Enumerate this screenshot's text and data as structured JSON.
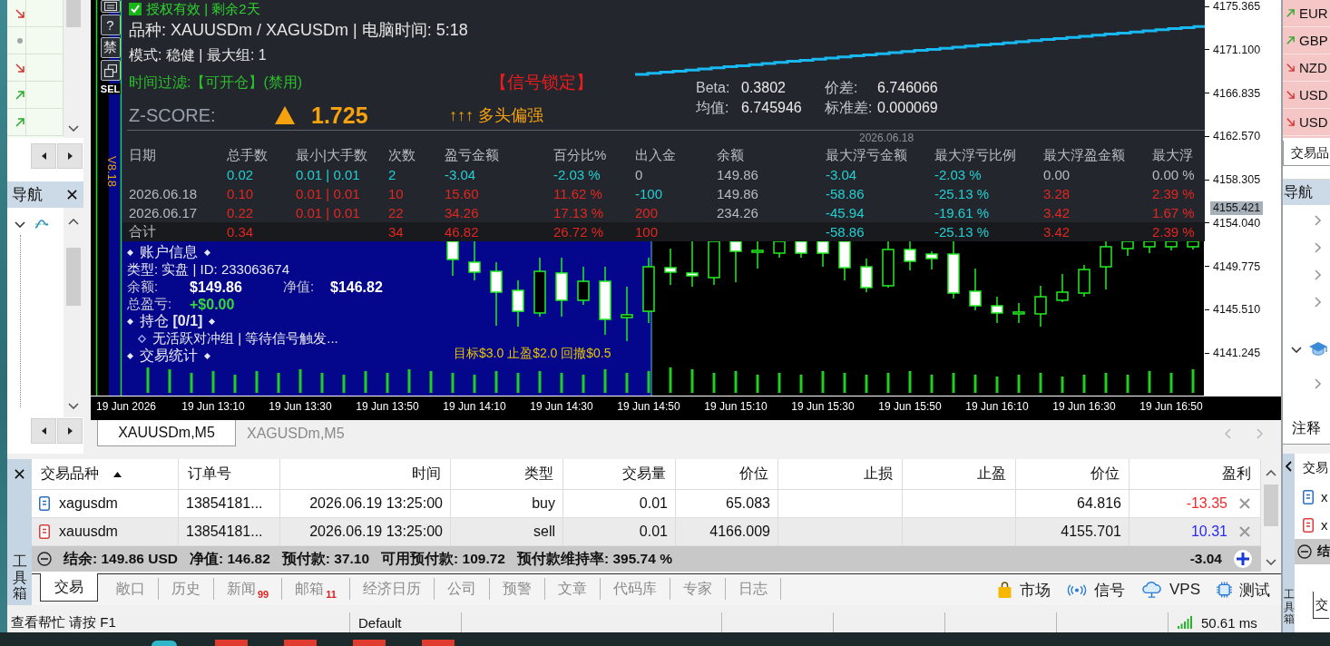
{
  "left_panel": {
    "market_rows": [
      {
        "kind": "down"
      },
      {
        "kind": "flat"
      },
      {
        "kind": "down"
      },
      {
        "kind": "up"
      },
      {
        "kind": "up"
      }
    ],
    "navigator_title": "导航",
    "navigator_tree": [
      {
        "kind": "indicators",
        "expanded": true
      }
    ]
  },
  "chart": {
    "side_buttons": [
      {
        "kind": "list"
      },
      {
        "kind": "text",
        "label": "?"
      },
      {
        "kind": "text",
        "label": "禁"
      },
      {
        "kind": "window"
      }
    ],
    "side_label": "SEL",
    "version": "V8.18",
    "panel": {
      "license": {
        "checked": true,
        "text": "授权有效 | 剩余2天"
      },
      "symbols": "品种: XAUUSDm / XAGUSDm  |  电脑时间: 5:18",
      "mode": "模式: 稳健 | 最大组: 1",
      "time_filter": "时间过滤:【可开仓】(禁用)",
      "signal": "【信号锁定】",
      "zscore": {
        "label": "Z-SCORE:",
        "rising": true,
        "value": "1.725",
        "bias": "↑↑↑ 多头偏强"
      },
      "stats": [
        {
          "label": "Beta:",
          "value": "0.3802"
        },
        {
          "label": "价差:",
          "value": "6.746066"
        },
        {
          "label": "均值:",
          "value": "6.745946"
        },
        {
          "label": "标准差:",
          "value": "0.000069"
        }
      ],
      "daily_table": {
        "date": "2026.06.18",
        "columns": [
          "日期",
          "总手数",
          "最小|大手数",
          "次数",
          "盈亏金额",
          "百分比%",
          "出入金",
          "余额",
          "最大浮亏金额",
          "最大浮亏比例",
          "最大浮盈金额",
          "最大浮"
        ],
        "rows": [
          {
            "kind": "day",
            "cells": [
              null,
              {
                "text": "0.02",
                "color": "#22d0d4"
              },
              {
                "text": "0.01 | 0.01",
                "color": "#22d0d4"
              },
              {
                "text": "2",
                "color": "#22d0d4"
              },
              {
                "text": "-3.04",
                "color": "#22d0d4"
              },
              {
                "text": "-2.03 %",
                "color": "#22d0d4"
              },
              {
                "text": "0",
                "color": "#b8bcc2"
              },
              {
                "text": "149.86",
                "color": "#b8bcc2"
              },
              {
                "text": "-3.04",
                "color": "#22d0d4"
              },
              {
                "text": "-2.03 %",
                "color": "#22d0d4"
              },
              {
                "text": "0.00",
                "color": "#b8bcc2"
              },
              {
                "text": "0.00 %",
                "color": "#b8bcc2"
              }
            ]
          },
          {
            "kind": "day",
            "cells": [
              {
                "text": "2026.06.18",
                "color": "#b8bcc2"
              },
              {
                "text": "0.10",
                "color": "#e42620"
              },
              {
                "text": "0.01 | 0.01",
                "color": "#e42620"
              },
              {
                "text": "10",
                "color": "#e42620"
              },
              {
                "text": "15.60",
                "color": "#e42620"
              },
              {
                "text": "11.62 %",
                "color": "#e42620"
              },
              {
                "text": "-100",
                "color": "#22d0d4"
              },
              {
                "text": "149.86",
                "color": "#b8bcc2"
              },
              {
                "text": "-58.86",
                "color": "#22d0d4"
              },
              {
                "text": "-25.13 %",
                "color": "#22d0d4"
              },
              {
                "text": "3.28",
                "color": "#e42620"
              },
              {
                "text": "2.39 %",
                "color": "#e42620"
              }
            ]
          },
          {
            "kind": "day",
            "cells": [
              {
                "text": "2026.06.17",
                "color": "#b8bcc2"
              },
              {
                "text": "0.22",
                "color": "#e42620"
              },
              {
                "text": "0.01 | 0.01",
                "color": "#e42620"
              },
              {
                "text": "22",
                "color": "#e42620"
              },
              {
                "text": "34.26",
                "color": "#e42620"
              },
              {
                "text": "17.13 %",
                "color": "#e42620"
              },
              {
                "text": "200",
                "color": "#e42620"
              },
              {
                "text": "234.26",
                "color": "#b8bcc2"
              },
              {
                "text": "-45.94",
                "color": "#22d0d4"
              },
              {
                "text": "-19.61 %",
                "color": "#22d0d4"
              },
              {
                "text": "3.42",
                "color": "#e42620"
              },
              {
                "text": "1.67 %",
                "color": "#e42620"
              }
            ]
          },
          {
            "kind": "total",
            "cells": [
              {
                "text": "合计",
                "color": "#b8bcc2"
              },
              {
                "text": "0.34",
                "color": "#e42620"
              },
              null,
              {
                "text": "34",
                "color": "#e42620"
              },
              {
                "text": "46.82",
                "color": "#e42620"
              },
              {
                "text": "26.72 %",
                "color": "#e42620"
              },
              {
                "text": "100",
                "color": "#e42620"
              },
              null,
              {
                "text": "-58.86",
                "color": "#22d0d4"
              },
              {
                "text": "-25.13 %",
                "color": "#22d0d4"
              },
              {
                "text": "3.42",
                "color": "#e42620"
              },
              {
                "text": "2.39 %",
                "color": "#e42620"
              }
            ]
          }
        ]
      }
    },
    "account": {
      "heading": "账户信息",
      "type_line": "类型: 实盘 | ID: 233063674",
      "balance": {
        "label": "余额:",
        "value": "$149.86"
      },
      "equity": {
        "label": "净值:",
        "value": "$146.82"
      },
      "pnl": {
        "label": "总盈亏:",
        "value": "+$0.00"
      },
      "positions_heading": "持仓 **[0/1]**",
      "positions_status": "无活跃对冲组 | 等待信号触发...",
      "stats_heading": "交易统计"
    },
    "targets": "目标$3.0 止盈$2.0 回撤$0.5",
    "current_price": "4155.421",
    "chart_data": {
      "type": "candlestick",
      "categories": [
        "19 Jun 2026",
        null,
        null,
        null,
        "19 Jun 13:10",
        null,
        null,
        null,
        "19 Jun 13:30",
        null,
        null,
        null,
        "19 Jun 13:50",
        null,
        null,
        null,
        "19 Jun 14:10",
        null,
        null,
        null,
        "19 Jun 14:30",
        null,
        null,
        null,
        "19 Jun 14:50",
        null,
        null,
        null,
        "19 Jun 15:10",
        null,
        null,
        null,
        "19 Jun 15:30",
        null,
        null,
        null,
        "19 Jun 15:50",
        null,
        null,
        null,
        "19 Jun 16:10",
        null,
        null,
        null,
        "19 Jun 16:30",
        null,
        null,
        null,
        "19 Jun 16:50",
        null
      ],
      "ohlc": [
        null,
        null,
        null,
        null,
        null,
        null,
        null,
        null,
        null,
        null,
        null,
        null,
        null,
        null,
        null,
        null,
        null,
        [
          4149.28,
          4150.18,
          4143.93,
          4147.23
        ],
        [
          4147.41,
          4148.39,
          4143.84,
          4145.35
        ],
        [
          4145.18,
          4150.62,
          4144.82,
          4149.28
        ],
        [
          4149.11,
          4150.62,
          4144.82,
          4146.43
        ],
        [
          4146.43,
          4149.73,
          4145.98,
          4148.3
        ],
        [
          4148.3,
          4149.73,
          4143.03,
          4144.55
        ],
        [
          4144.73,
          4147.77,
          4142.41,
          4145.0
        ],
        [
          4145.35,
          4150.62,
          4144.19,
          4149.73
        ],
        [
          4149.64,
          4151.52,
          4147.94,
          4149.2
        ],
        null,
        null,
        null,
        null,
        null,
        null,
        null,
        null,
        [
          4149.73,
          4150.54,
          4147.23,
          4147.68
        ],
        null,
        null,
        [
          4150.98,
          4151.25,
          4149.46,
          4150.54
        ],
        null,
        [
          4147.32,
          4149.55,
          4145.44,
          4145.89
        ],
        [
          4145.89,
          4146.78,
          4144.19,
          4145.18
        ],
        [
          4145.09,
          4146.16,
          4144.19,
          4145.27
        ],
        [
          4145.09,
          4147.86,
          4143.84,
          4146.78
        ],
        [
          4146.43,
          4149.02,
          4146.25,
          4147.23
        ],
        [
          4147.14,
          4149.91,
          4146.78,
          4149.46
        ],
        null,
        null,
        null,
        null,
        null
      ],
      "ylim": [
        4136.96,
        4175.99
      ],
      "yticks": [
        {
          "value": 4175.365,
          "label": "4175.365"
        },
        {
          "value": 4171.1,
          "label": "4171.100"
        },
        {
          "value": 4166.835,
          "label": "4166.835"
        },
        {
          "value": 4162.57,
          "label": "4162.570"
        },
        {
          "value": 4158.305,
          "label": "4158.305"
        },
        {
          "value": 4154.04,
          "label": "4154.040"
        },
        {
          "value": 4149.775,
          "label": "4149.775"
        },
        {
          "value": 4145.51,
          "label": "4145.510"
        },
        {
          "value": 4141.245,
          "label": "4141.245"
        }
      ]
    }
  },
  "chart_tabs": [
    {
      "label": "XAUUSDm,M5",
      "selected": true
    },
    {
      "label": "XAGUSDm,M5",
      "selected": false
    }
  ],
  "trade_table": {
    "columns": [
      {
        "label": "交易品种",
        "sorted": true
      },
      {
        "label": "订单号",
        "sorted": false
      },
      {
        "label": "时间",
        "sorted": false
      },
      {
        "label": "类型",
        "sorted": false
      },
      {
        "label": "交易量",
        "sorted": false
      },
      {
        "label": "价位",
        "sorted": false
      },
      {
        "label": "止损",
        "sorted": false
      },
      {
        "label": "止盈",
        "sorted": false
      },
      {
        "label": "价位",
        "sorted": false
      },
      {
        "label": "盈利",
        "sorted": false
      }
    ],
    "rows": [
      {
        "kind": "buy",
        "cells": [
          "xagusdm",
          "13854181...",
          "2026.06.19 13:25:00",
          "buy",
          "0.01",
          "65.083",
          null,
          null,
          "64.816"
        ],
        "profit": {
          "text": "-13.35",
          "color": "#f42a2a"
        }
      },
      {
        "kind": "sell",
        "cells": [
          "xauusdm",
          "13854181...",
          "2026.06.19 13:25:00",
          "sell",
          "0.01",
          "4166.009",
          null,
          null,
          "4155.701"
        ],
        "profit": {
          "text": "10.31",
          "color": "#2a2af0"
        }
      }
    ],
    "summary": {
      "items": [
        "结余: 149.86 USD",
        "净值: 146.82",
        "预付款: 37.10",
        "可用预付款: 109.72",
        "预付款维持率: 395.74 %"
      ],
      "total": "-3.04"
    }
  },
  "toolbox": {
    "label": "工具箱",
    "tabs": [
      {
        "label": "交易",
        "selected": true
      },
      {
        "label": "敞口",
        "selected": false
      },
      {
        "label": "历史",
        "selected": false
      },
      {
        "label": "新闻",
        "selected": false,
        "badge": "99"
      },
      {
        "label": "邮箱",
        "selected": false,
        "badge": "11"
      },
      {
        "label": "经济日历",
        "selected": false
      },
      {
        "label": "公司",
        "selected": false
      },
      {
        "label": "预警",
        "selected": false
      },
      {
        "label": "文章",
        "selected": false
      },
      {
        "label": "代码库",
        "selected": false
      },
      {
        "label": "专家",
        "selected": false
      },
      {
        "label": "日志",
        "selected": false
      }
    ],
    "links": [
      {
        "kind": "market",
        "label": "市场"
      },
      {
        "kind": "signals",
        "label": "信号"
      },
      {
        "kind": "vps",
        "label": "VPS"
      },
      {
        "kind": "tester",
        "label": "测试"
      }
    ]
  },
  "status_bar": {
    "help": "查看帮忙 请按 F1",
    "profile": "Default",
    "ping": "50.61 ms"
  },
  "right_panel": {
    "market_rows": [
      {
        "kind": "up",
        "symbol": "EUR"
      },
      {
        "kind": "up",
        "symbol": "GBP"
      },
      {
        "kind": "down",
        "symbol": "NZD"
      },
      {
        "kind": "down",
        "symbol": "USD"
      },
      {
        "kind": "down",
        "symbol": "USD"
      }
    ],
    "market_tab": "交易品",
    "navigator_title": "导航",
    "tree": [
      {
        "expanded": false
      },
      {
        "expanded": false
      },
      {
        "expanded": false
      },
      {
        "expanded": false
      },
      {
        "kind": "course",
        "expanded": true,
        "children": [
          {
            "expanded": false
          }
        ]
      }
    ],
    "notes_tab": "注释",
    "toolbox": {
      "label": "工具箱",
      "header": "交易",
      "rows": [
        {
          "kind": "buy",
          "symbol": "x"
        },
        {
          "kind": "sell",
          "symbol": "x"
        }
      ],
      "summary": "结",
      "tab": "交"
    }
  }
}
